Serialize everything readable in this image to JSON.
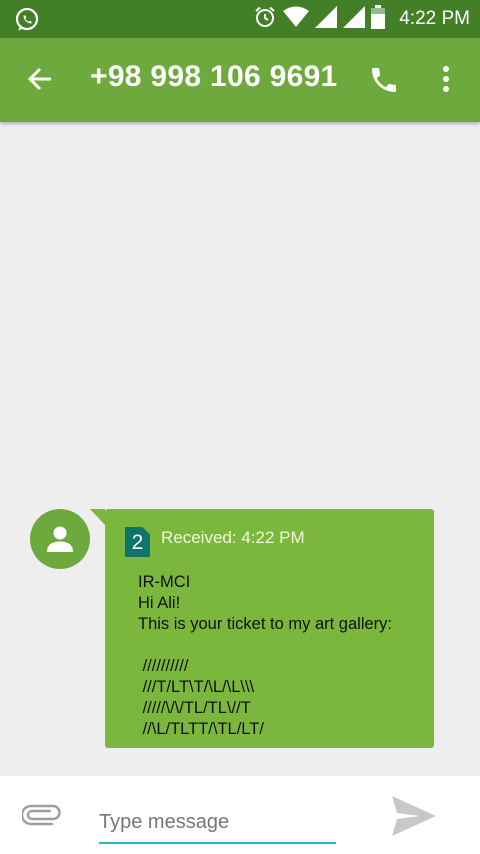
{
  "status_bar": {
    "time": "4:22 PM"
  },
  "toolbar": {
    "title": "+98 998 106 9691"
  },
  "message": {
    "sim_number": "2",
    "received_label": "Received: 4:22 PM",
    "body": "IR-MCI\nHi Ali!\nThis is your ticket to my art gallery:\n\n //////////\n ///T/LT\\T/\\L/\\L\\\\\\\n /////\\/\\/TL/TL\\//T\n //\\L/TLTT/\\TL/LT/"
  },
  "compose": {
    "placeholder": "Type message"
  },
  "colors": {
    "status_bar": "#437f27",
    "toolbar": "#6ea93d",
    "bubble": "#7ab73c",
    "sim_badge": "#0f7569",
    "input_underline": "#2bb3c0"
  }
}
